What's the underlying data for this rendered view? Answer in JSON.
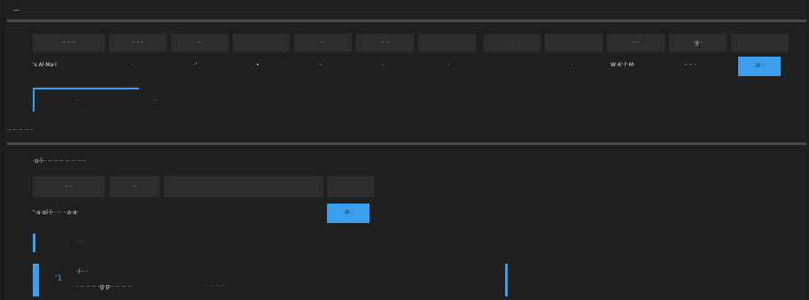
{
  "top": {
    "title": "—"
  },
  "table1": {
    "headers": [
      "·· ·· ··",
      "·· · ··",
      "··",
      "",
      "··",
      "·· ··",
      "",
      "·",
      "",
      "·· ·",
      "·g··",
      ""
    ],
    "row": {
      "name": "'s Al·Ma·l",
      "cells": [
        "·",
        "·'",
        "•",
        "··",
        "·",
        "·",
        "",
        "·",
        "W·A'·l'·M·",
        "·· ·· ·"
      ],
      "action": "·'A'·'·"
    }
  },
  "tabs": {
    "tab1": "··",
    "tab2": "··"
  },
  "section1": {
    "label": "·· ·· ·· ·· ·"
  },
  "section2": {
    "title": "·o·l·· ·· ·· ·· ·· ·· ·· ·",
    "headers": [
      "·· ··",
      "··",
      "",
      ""
    ],
    "row_label": "'·a·al·l·· ·· ··a·a·",
    "action": "·P··"
  },
  "list": {
    "item1": "··'·",
    "item2_title": "·l·· ·",
    "item2_desc": "· ·· ·· ·· ·g·p·· ·· ·· ··",
    "item2_link": "·· ·· ·· ··",
    "item2_icon_text": "'1"
  }
}
